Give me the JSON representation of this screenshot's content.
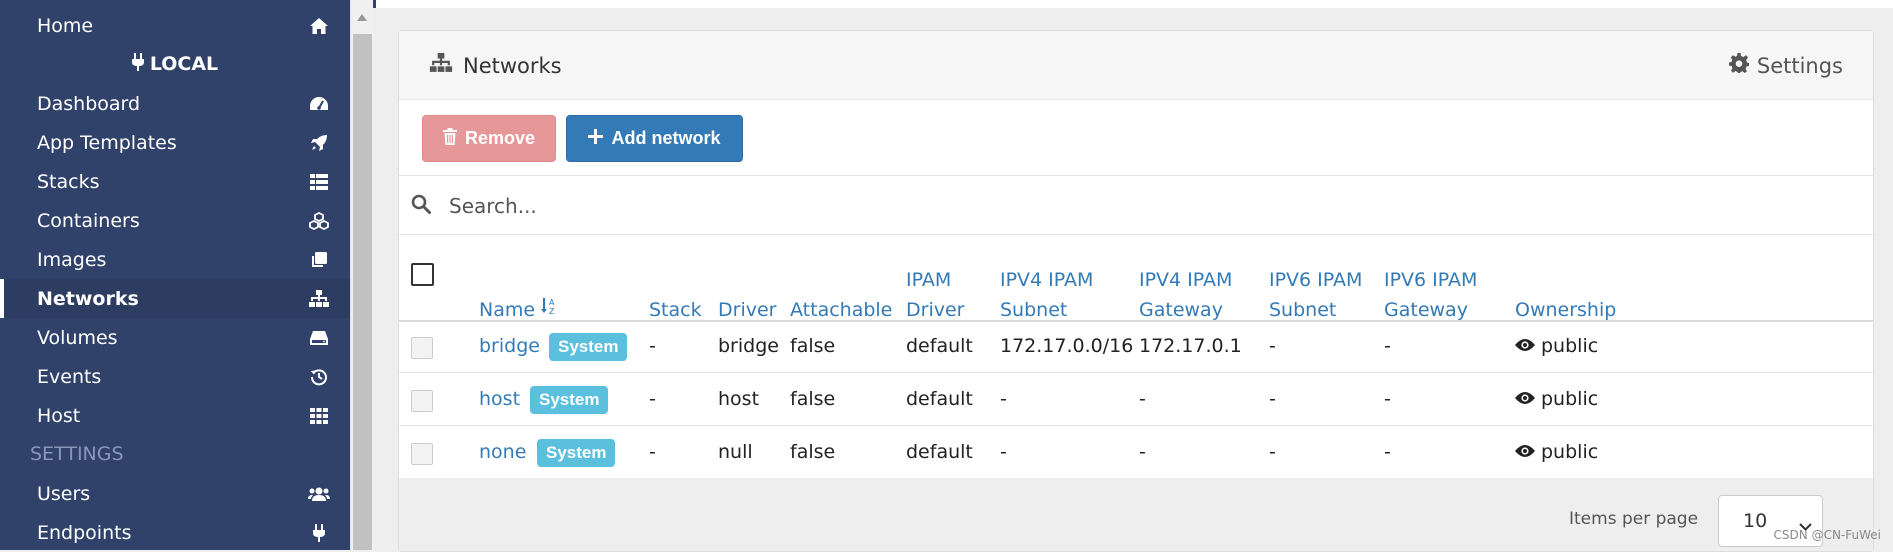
{
  "sidebar": {
    "items": [
      {
        "label": "Home",
        "icon": "home-icon"
      },
      {
        "label": "Dashboard",
        "icon": "tachometer-icon"
      },
      {
        "label": "App Templates",
        "icon": "rocket-icon"
      },
      {
        "label": "Stacks",
        "icon": "th-list-icon"
      },
      {
        "label": "Containers",
        "icon": "cubes-icon"
      },
      {
        "label": "Images",
        "icon": "clone-icon"
      },
      {
        "label": "Networks",
        "icon": "sitemap-icon",
        "active": true
      },
      {
        "label": "Volumes",
        "icon": "hdd-icon"
      },
      {
        "label": "Events",
        "icon": "history-icon"
      },
      {
        "label": "Host",
        "icon": "th-icon"
      }
    ],
    "endpoint": "LOCAL",
    "settings_section": "SETTINGS",
    "settings_items": [
      {
        "label": "Users",
        "icon": "users-icon"
      },
      {
        "label": "Endpoints",
        "icon": "plug-icon"
      }
    ]
  },
  "panel": {
    "title": "Networks",
    "settings_label": "Settings"
  },
  "actions": {
    "remove_label": "Remove",
    "add_label": "Add network"
  },
  "search": {
    "placeholder": "Search..."
  },
  "table": {
    "headers": {
      "name": "Name",
      "stack": "Stack",
      "driver": "Driver",
      "attachable": "Attachable",
      "ipam_driver_1": "IPAM",
      "ipam_driver_2": "Driver",
      "ipv4_subnet_1": "IPV4 IPAM",
      "ipv4_subnet_2": "Subnet",
      "ipv4_gateway_1": "IPV4 IPAM",
      "ipv4_gateway_2": "Gateway",
      "ipv6_subnet_1": "IPV6 IPAM",
      "ipv6_subnet_2": "Subnet",
      "ipv6_gateway_1": "IPV6 IPAM",
      "ipv6_gateway_2": "Gateway",
      "ownership": "Ownership"
    },
    "rows": [
      {
        "name": "bridge",
        "badge": "System",
        "stack": "-",
        "driver": "bridge",
        "attachable": "false",
        "ipam_driver": "default",
        "ipv4_subnet": "172.17.0.0/16",
        "ipv4_gateway": "172.17.0.1",
        "ipv6_subnet": "-",
        "ipv6_gateway": "-",
        "ownership": "public"
      },
      {
        "name": "host",
        "badge": "System",
        "stack": "-",
        "driver": "host",
        "attachable": "false",
        "ipam_driver": "default",
        "ipv4_subnet": "-",
        "ipv4_gateway": "-",
        "ipv6_subnet": "-",
        "ipv6_gateway": "-",
        "ownership": "public"
      },
      {
        "name": "none",
        "badge": "System",
        "stack": "-",
        "driver": "null",
        "attachable": "false",
        "ipam_driver": "default",
        "ipv4_subnet": "-",
        "ipv4_gateway": "-",
        "ipv6_subnet": "-",
        "ipv6_gateway": "-",
        "ownership": "public"
      }
    ]
  },
  "pagination": {
    "items_per_page_label": "Items per page",
    "items_per_page_value": "10"
  },
  "watermark": "CSDN @CN-FuWei",
  "colors": {
    "sidebar_bg": "#30426a",
    "link_blue": "#337ab7",
    "badge_info": "#5bc0de",
    "danger_light": "#e59897"
  }
}
